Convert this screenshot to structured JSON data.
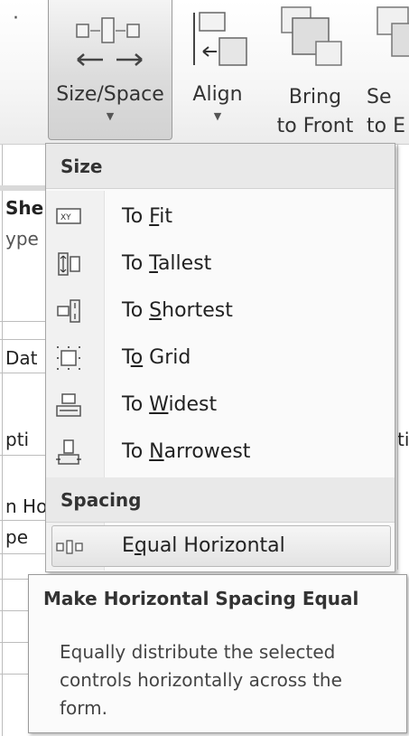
{
  "ribbon": {
    "size_space": {
      "label": "Size/Space",
      "icon": "size-space-icon"
    },
    "align": {
      "label": "Align",
      "icon": "align-icon"
    },
    "bring_to_front": {
      "label_line1": "Bring",
      "label_line2": "to Front",
      "icon": "bring-to-front-icon"
    },
    "send_to_back": {
      "label_line1": "Se",
      "label_line2": "to E",
      "icon": "send-to-back-icon"
    }
  },
  "background": {
    "left_fragments": [
      "She",
      "ype",
      "Dat",
      "pti",
      "n Ho",
      "pe"
    ],
    "right_fragment": "ti"
  },
  "menu": {
    "size_section": "Size",
    "size_items": [
      {
        "pre": "To ",
        "key": "F",
        "post": "it",
        "icon": "to-fit-icon"
      },
      {
        "pre": "To ",
        "key": "T",
        "post": "allest",
        "icon": "to-tallest-icon"
      },
      {
        "pre": "To ",
        "key": "S",
        "post": "hortest",
        "icon": "to-shortest-icon"
      },
      {
        "pre": "T",
        "key": "o",
        "post": " Grid",
        "icon": "to-grid-icon"
      },
      {
        "pre": "To ",
        "key": "W",
        "post": "idest",
        "icon": "to-widest-icon"
      },
      {
        "pre": "To ",
        "key": "N",
        "post": "arrowest",
        "icon": "to-narrowest-icon"
      }
    ],
    "spacing_section": "Spacing",
    "spacing_items": [
      {
        "pre": "E",
        "key": "q",
        "post": "ual Horizontal",
        "icon": "equal-horizontal-icon",
        "highlighted": true
      }
    ]
  },
  "tooltip": {
    "title": "Make Horizontal Spacing Equal",
    "line1": "Equally distribute the selected",
    "line2": "controls horizontally across the",
    "line3": "form."
  }
}
